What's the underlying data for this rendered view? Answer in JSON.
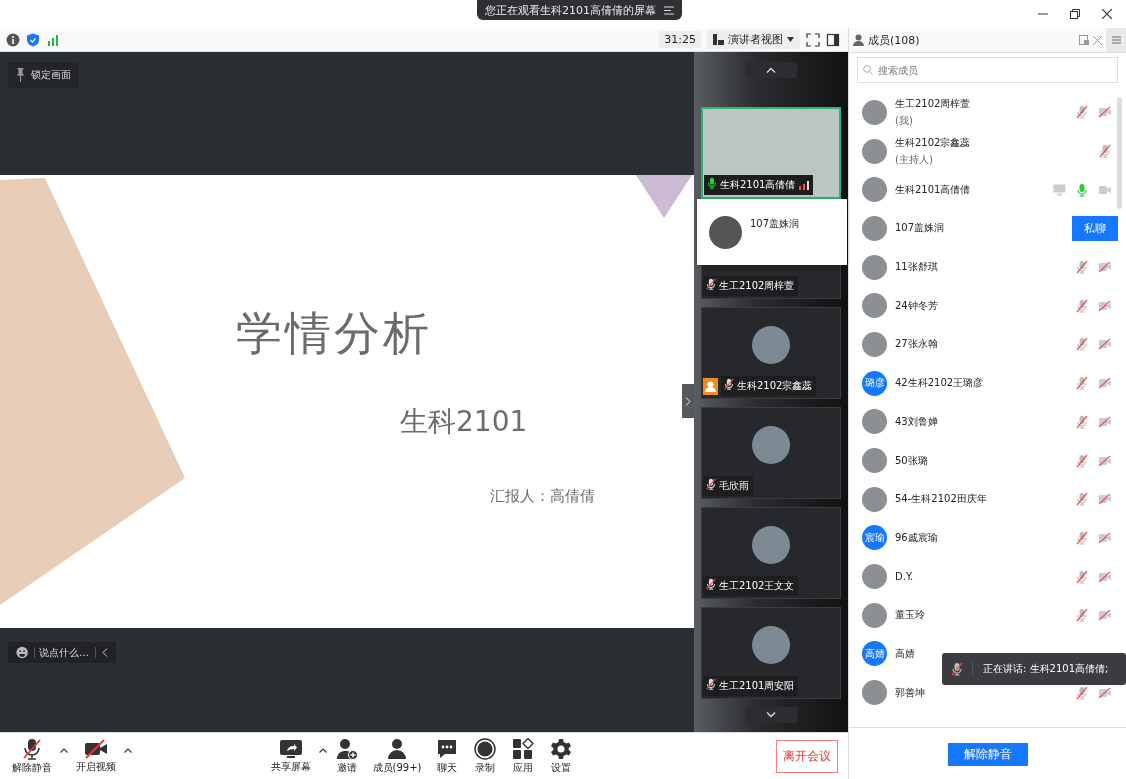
{
  "title_bar": {
    "banner": "您正在观看生科2101高倩倩的屏幕"
  },
  "toolbar": {
    "timer": "31:25",
    "view_button": "演讲者视图"
  },
  "share": {
    "lock_button": "锁定画面",
    "slide": {
      "title": "学情分析",
      "subtitle": "生科2101",
      "presenter": "汇报人：高倩倩"
    },
    "chat": {
      "placeholder": "说点什么..."
    }
  },
  "videos": [
    {
      "name": "生科2101高倩倩",
      "kind": "video",
      "muted": false,
      "speaking": true,
      "host": false
    },
    {
      "name": "生工2102周梓萱",
      "kind": "avatar",
      "muted": true,
      "speaking": false,
      "host": false
    },
    {
      "name": "生科2102宗鑫蕊",
      "kind": "avatar",
      "muted": true,
      "speaking": false,
      "host": true
    },
    {
      "name": "毛欣雨",
      "kind": "avatar",
      "muted": true,
      "speaking": false,
      "host": false
    },
    {
      "name": "生工2102王文文",
      "kind": "avatar",
      "muted": true,
      "speaking": false,
      "host": false
    },
    {
      "name": "生工2101周安阳",
      "kind": "avatar",
      "muted": true,
      "speaking": false,
      "host": false
    }
  ],
  "hover_card": {
    "name": "107盖姝润"
  },
  "members": {
    "title": "成员(108)",
    "search_placeholder": "搜索成员",
    "items": [
      {
        "name": "生工2102周梓萱",
        "note": "(我)",
        "kind": "photo",
        "mic_muted": true,
        "camera_off": true,
        "sharing": false
      },
      {
        "name": "生科2102宗鑫蕊",
        "note": "(主持人)",
        "kind": "photo",
        "mic_muted": true,
        "sharing": false
      },
      {
        "name": "生科2101高倩倩",
        "kind": "photo",
        "mic_muted": false,
        "camera_off": false,
        "sharing": true
      },
      {
        "name": "107盖姝润",
        "kind": "photo",
        "chat_button": "私聊",
        "sharing": false
      },
      {
        "name": "11张舒琪",
        "kind": "photo",
        "mic_muted": true,
        "camera_off": true,
        "sharing": false
      },
      {
        "name": "24钟冬芳",
        "kind": "photo",
        "mic_muted": true,
        "camera_off": true,
        "sharing": false
      },
      {
        "name": "27张永翰",
        "kind": "photo",
        "mic_muted": true,
        "camera_off": true,
        "sharing": false
      },
      {
        "name": "42生科2102王璐彦",
        "kind": "initials",
        "avatar_text": "璐彦",
        "mic_muted": true,
        "camera_off": true,
        "sharing": false
      },
      {
        "name": "43刘鲁婵",
        "kind": "photo",
        "mic_muted": true,
        "camera_off": true,
        "sharing": false
      },
      {
        "name": "50张璐",
        "kind": "photo",
        "mic_muted": true,
        "camera_off": true,
        "sharing": false
      },
      {
        "name": "54-生科2102田庆年",
        "kind": "photo",
        "mic_muted": true,
        "camera_off": true,
        "sharing": false
      },
      {
        "name": "96戚宸瑜",
        "kind": "initials",
        "avatar_text": "宸瑜",
        "mic_muted": true,
        "camera_off": true,
        "sharing": false
      },
      {
        "name": "D.Y.",
        "kind": "photo",
        "mic_muted": true,
        "camera_off": true,
        "sharing": false
      },
      {
        "name": "董玉玲",
        "kind": "photo",
        "mic_muted": true,
        "camera_off": true,
        "sharing": false
      },
      {
        "name": "高婧",
        "kind": "initials",
        "avatar_text": "高婧",
        "sharing": false
      },
      {
        "name": "郭善坤",
        "kind": "photo",
        "mic_muted": true,
        "camera_off": true,
        "sharing": false
      }
    ],
    "unmute_button": "解除静音"
  },
  "toast": {
    "text": "正在讲话: 生科2101高倩倩;"
  },
  "media_controls": [
    {
      "kind": "mic",
      "label": "解除静音",
      "caret": true
    },
    {
      "kind": "camera",
      "label": "开启视频",
      "caret": true
    }
  ],
  "meeting_controls": [
    {
      "kind": "share",
      "label": "共享屏幕",
      "caret": true
    },
    {
      "kind": "invite",
      "label": "邀请",
      "caret": false
    },
    {
      "kind": "members",
      "label": "成员(99+)",
      "caret": false
    },
    {
      "kind": "chat",
      "label": "聊天",
      "caret": false
    },
    {
      "kind": "record",
      "label": "录制",
      "caret": false
    },
    {
      "kind": "apps",
      "label": "应用",
      "caret": false
    },
    {
      "kind": "settings",
      "label": "设置",
      "caret": false
    }
  ],
  "leave_button": "离开会议"
}
